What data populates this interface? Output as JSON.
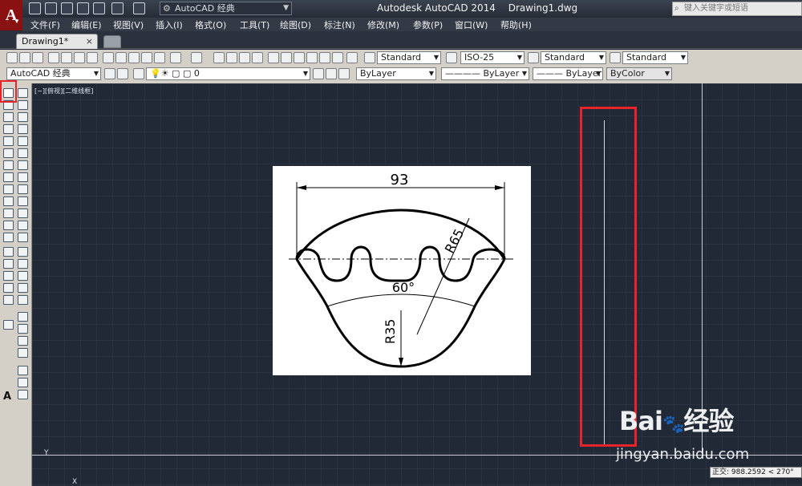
{
  "app": {
    "logo_letter": "A",
    "window_title": "Autodesk AutoCAD 2014",
    "document_name": "Drawing1.dwg",
    "workspace": "AutoCAD 经典",
    "search_placeholder": "键入关键字或短语"
  },
  "menu": [
    {
      "label": "文件(F)"
    },
    {
      "label": "编辑(E)"
    },
    {
      "label": "视图(V)"
    },
    {
      "label": "插入(I)"
    },
    {
      "label": "格式(O)"
    },
    {
      "label": "工具(T)"
    },
    {
      "label": "绘图(D)"
    },
    {
      "label": "标注(N)"
    },
    {
      "label": "修改(M)"
    },
    {
      "label": "参数(P)"
    },
    {
      "label": "窗口(W)"
    },
    {
      "label": "帮助(H)"
    }
  ],
  "tabs": {
    "active_label": "Drawing1*",
    "close_glyph": "×"
  },
  "toolbar": {
    "text_style": "Standard",
    "dim_style": "ISO-25",
    "table_style": "Standard",
    "multileader_style": "Standard",
    "workspace_combo": "AutoCAD 经典",
    "layer": "0",
    "color": "ByLayer",
    "linetype": "ByLayer",
    "lineweight": "ByLayer",
    "plot_style": "ByColor"
  },
  "canvas": {
    "viewport_label": "[−][俯视][二维线框]",
    "ucs_glyph": "Y",
    "ucs_glyph_2": "X"
  },
  "reference_drawing": {
    "width_dim": "93",
    "radius_top": "R65",
    "angle": "60°",
    "radius_bottom": "R35"
  },
  "watermark": {
    "logo": "Bai",
    "logo_suffix": "经验",
    "url": "jingyan.baidu.com"
  },
  "status": {
    "tooltip": "正交: 988.2592 < 270°"
  },
  "colors": {
    "highlight": "#e8232a",
    "canvas_bg": "#212836"
  }
}
